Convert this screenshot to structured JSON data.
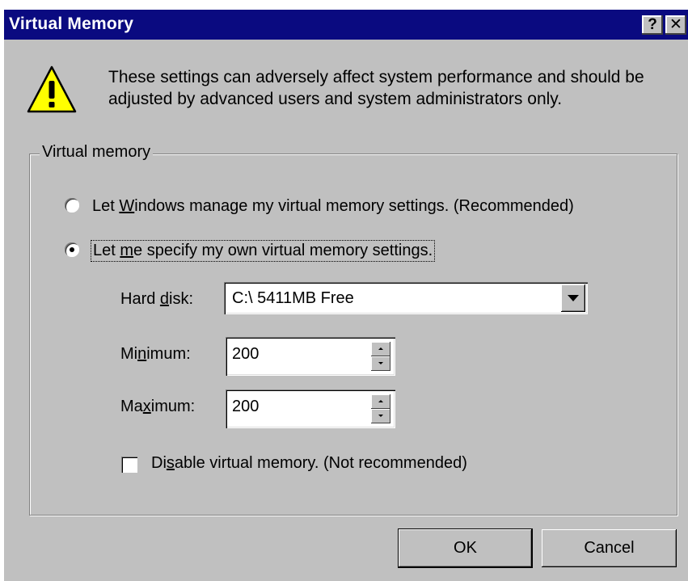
{
  "window": {
    "title": "Virtual Memory",
    "help_glyph": "?",
    "close_glyph": "✕"
  },
  "warning": {
    "icon": "warning-icon",
    "text": "These settings can adversely affect system performance and should be adjusted by advanced users and system administrators only."
  },
  "group": {
    "label": "Virtual memory",
    "options": [
      {
        "before": "Let ",
        "mnemonic": "W",
        "after": "indows manage my virtual memory settings. (Recommended)",
        "selected": false
      },
      {
        "before": "Let ",
        "mnemonic": "m",
        "after": "e specify my own virtual memory settings.",
        "selected": true
      }
    ],
    "hard_disk": {
      "before": "Hard ",
      "mnemonic": "d",
      "after": "isk:",
      "value": "C:\\ 5411MB Free"
    },
    "minimum": {
      "before": "Mi",
      "mnemonic": "n",
      "after": "imum:",
      "value": "200"
    },
    "maximum": {
      "before": "Ma",
      "mnemonic": "x",
      "after": "imum:",
      "value": "200"
    },
    "disable": {
      "before": "Di",
      "mnemonic": "s",
      "after": "able virtual memory. (Not recommended)",
      "checked": false
    }
  },
  "buttons": {
    "ok": "OK",
    "cancel": "Cancel"
  },
  "colors": {
    "titlebar": "#0a0a80",
    "face": "#c0c0c0",
    "warning_yellow": "#ffff00"
  }
}
